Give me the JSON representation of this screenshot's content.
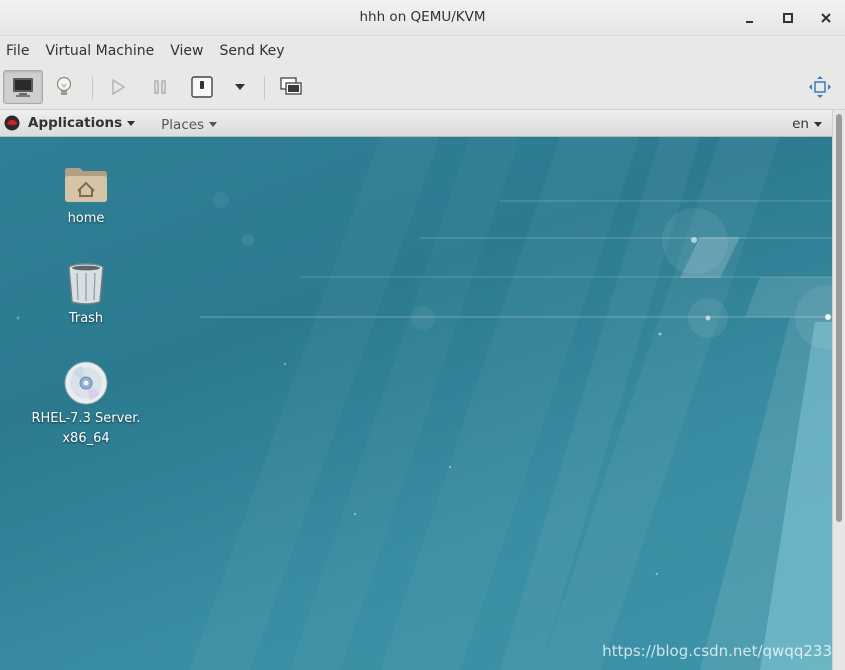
{
  "window": {
    "title": "hhh on QEMU/KVM",
    "buttons": [
      "minimize-icon",
      "maximize-icon",
      "close-icon"
    ]
  },
  "menubar": {
    "items": [
      "File",
      "Virtual Machine",
      "View",
      "Send Key"
    ]
  },
  "toolbar": {
    "buttons": [
      "console-icon",
      "details-lightbulb-icon",
      "run-icon",
      "pause-icon",
      "shutdown-icon",
      "dropdown-arrow-icon",
      "snapshots-icon",
      "fullscreen-icon"
    ],
    "active": "console-icon"
  },
  "guest": {
    "topbar": {
      "applications_label": "Applications",
      "places_label": "Places",
      "language": "en"
    },
    "desktop_icons": [
      {
        "label": "home",
        "icon": "home-folder-icon"
      },
      {
        "label": "Trash",
        "icon": "trash-icon"
      },
      {
        "label_line1": "RHEL-7.3 Server.",
        "label_line2": "x86_64",
        "icon": "disc-icon"
      }
    ],
    "watermark": "https://blog.csdn.net/qwqq233"
  },
  "colors": {
    "desktop": "#2f7f96",
    "topbar": "#e6e6e6",
    "chrome": "#e8e8e7"
  }
}
